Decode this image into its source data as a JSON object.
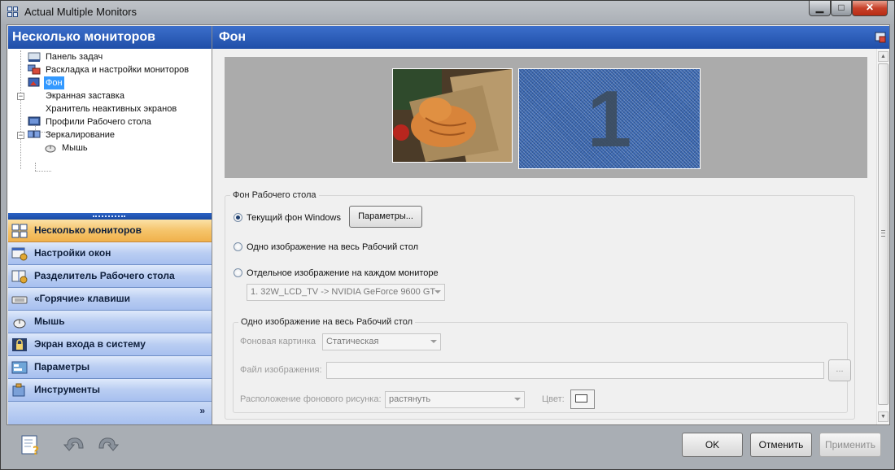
{
  "window": {
    "title": "Actual Multiple Monitors",
    "controls": {
      "minimize": "▁",
      "maximize": "□",
      "close": "✕"
    }
  },
  "left_panel": {
    "header": "Несколько мониторов",
    "tree": [
      {
        "label": "Панель задач",
        "icon": "taskbar-icon",
        "level": 1
      },
      {
        "label": "Раскладка и настройки мониторов",
        "icon": "monitors-layout-icon",
        "level": 1
      },
      {
        "label": "Фон",
        "icon": "background-icon",
        "level": 1,
        "selected": true
      },
      {
        "label": "Экранная заставка",
        "icon": "screensaver-icon",
        "level": 1,
        "expanded": true
      },
      {
        "label": "Хранитель неактивных экранов",
        "icon": "none",
        "level": 2
      },
      {
        "label": "Профили Рабочего стола",
        "icon": "desktop-profiles-icon",
        "level": 1
      },
      {
        "label": "Зеркалирование",
        "icon": "mirroring-icon",
        "level": 1,
        "expanded": true
      },
      {
        "label": "Мышь",
        "icon": "mouse-icon",
        "level": 2
      }
    ],
    "nav": [
      {
        "label": "Несколько мониторов",
        "icon": "multi-monitor-icon",
        "active": true
      },
      {
        "label": "Настройки окон",
        "icon": "window-settings-icon"
      },
      {
        "label": "Разделитель Рабочего стола",
        "icon": "desktop-divider-icon"
      },
      {
        "label": "«Горячие» клавиши",
        "icon": "keyboard-icon"
      },
      {
        "label": "Мышь",
        "icon": "mouse-icon"
      },
      {
        "label": "Экран входа в систему",
        "icon": "lock-icon"
      },
      {
        "label": "Параметры",
        "icon": "parameters-icon"
      },
      {
        "label": "Инструменты",
        "icon": "tools-icon"
      }
    ],
    "footer_chevron": "»"
  },
  "right_panel": {
    "header": "Фон",
    "preview": {
      "monitor2_number": "1"
    },
    "desktop_background": {
      "group_title": "Фон Рабочего стола",
      "option_current": "Текущий фон Windows",
      "params_button": "Параметры...",
      "option_single": "Одно изображение на весь Рабочий стол",
      "option_each": "Отдельное изображение на каждом мониторе",
      "monitor_select": "1. 32W_LCD_TV -> NVIDIA GeForce 9600 GT",
      "selected_option": "current"
    },
    "single_image": {
      "group_title": "Одно изображение на весь Рабочий стол",
      "bg_picture_label": "Фоновая картинка",
      "bg_picture_value": "Статическая",
      "image_file_label": "Файл изображения:",
      "image_file_value": "",
      "browse_button": "...",
      "position_label": "Расположение фонового рисунка:",
      "position_value": "растянуть",
      "color_label": "Цвет:"
    }
  },
  "footer": {
    "ok": "OK",
    "cancel": "Отменить",
    "apply": "Применить",
    "icons": [
      "help-icon",
      "undo-icon",
      "redo-icon"
    ]
  },
  "colors": {
    "header_blue": "#1f4ea8",
    "nav_active": "#f0b14b",
    "selection": "#3399ff"
  }
}
